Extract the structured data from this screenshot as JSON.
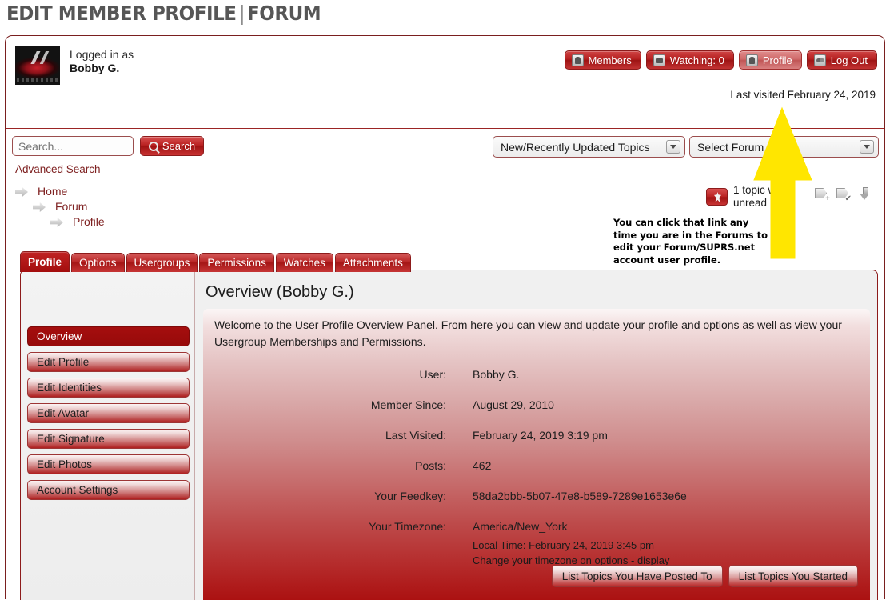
{
  "page": {
    "title_main": "EDIT MEMBER PROFILE",
    "title_sep": "|",
    "title_sub": "FORUM"
  },
  "header": {
    "avatar_name": "forum-logo-avatar",
    "logged_in_label": "Logged in as",
    "user_name": "Bobby G.",
    "last_visited": "Last visited February 24, 2019",
    "nav_buttons": [
      {
        "label": "Members",
        "icon": "members-icon",
        "active": false
      },
      {
        "label": "Watching: 0",
        "icon": "binoculars-icon",
        "active": false
      },
      {
        "label": "Profile",
        "icon": "person-icon",
        "active": true
      },
      {
        "label": "Log Out",
        "icon": "key-icon",
        "active": false
      }
    ]
  },
  "search": {
    "placeholder": "Search...",
    "value": "",
    "button_label": "Search",
    "advanced_label": "Advanced Search"
  },
  "dropdowns": {
    "topics": {
      "selected": "New/Recently Updated Topics"
    },
    "forum": {
      "selected": "Select Forum"
    }
  },
  "breadcrumbs": [
    {
      "label": "Home"
    },
    {
      "label": "Forum"
    },
    {
      "label": "Profile"
    }
  ],
  "notifications": {
    "unread_text": "1 topic with unread posts",
    "icons": [
      {
        "name": "mark-topic-read-icon"
      },
      {
        "name": "mark-all-read-icon"
      },
      {
        "name": "jump-to-bottom-icon"
      }
    ]
  },
  "callout": {
    "text": "You can click that link any time you are in the Forums to edit your Forum/SUPRS.net account user profile.",
    "arrow_color": "#FFE600"
  },
  "tabs": [
    {
      "label": "Profile",
      "active": true
    },
    {
      "label": "Options",
      "active": false
    },
    {
      "label": "Usergroups",
      "active": false
    },
    {
      "label": "Permissions",
      "active": false
    },
    {
      "label": "Watches",
      "active": false
    },
    {
      "label": "Attachments",
      "active": false
    }
  ],
  "sidebar": {
    "items": [
      {
        "label": "Overview",
        "active": true
      },
      {
        "label": "Edit Profile",
        "active": false
      },
      {
        "label": "Edit Identities",
        "active": false
      },
      {
        "label": "Edit Avatar",
        "active": false
      },
      {
        "label": "Edit Signature",
        "active": false
      },
      {
        "label": "Edit Photos",
        "active": false
      },
      {
        "label": "Account Settings",
        "active": false
      }
    ]
  },
  "main": {
    "title": "Overview (Bobby G.)",
    "welcome": "Welcome to the User Profile Overview Panel. From here you can view and update your profile and options as well as view your Usergroup Memberships and Permissions.",
    "rows": [
      {
        "label": "User:",
        "value": "Bobby G."
      },
      {
        "label": "Member Since:",
        "value": "August 29, 2010"
      },
      {
        "label": "Last Visited:",
        "value": "February 24, 2019 3:19 pm"
      },
      {
        "label": "Posts:",
        "value": "462"
      },
      {
        "label": "Your Feedkey:",
        "value": "58da2bbb-5b07-47e8-b589-7289e1653e6e"
      }
    ],
    "timezone": {
      "label": "Your Timezone:",
      "value": "America/New_York",
      "local_time": "Local Time: February 24, 2019 3:45 pm",
      "change_link": "Change your timezone on options - display"
    },
    "cta_buttons": [
      {
        "label": "List Topics You Have Posted To"
      },
      {
        "label": "List Topics You Started"
      }
    ]
  },
  "colors": {
    "accent_red": "#AE1F1F",
    "dark_red": "#8D1B1B",
    "link_red": "#7F2222",
    "title_grey": "#565656",
    "highlight_yellow": "#FFE600"
  }
}
